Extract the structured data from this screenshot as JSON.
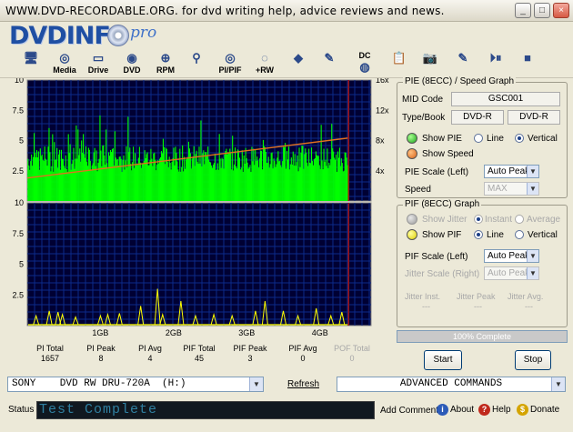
{
  "window": {
    "title": "WWW.DVD-RECORDABLE.ORG.    for dvd writing help, advice reviews and news.",
    "controls": [
      "_",
      "□",
      "×"
    ]
  },
  "logo": {
    "main": "DVDINF",
    "suffix": "pro"
  },
  "toolbar": [
    {
      "label": "",
      "icon": "monitor-icon"
    },
    {
      "label": "Media",
      "icon": "disc-icon"
    },
    {
      "label": "Drive",
      "icon": "drive-icon"
    },
    {
      "label": "DVD",
      "icon": "dvd-icon"
    },
    {
      "label": "RPM",
      "icon": "rpm-icon"
    },
    {
      "label": "",
      "icon": "scan-icon"
    },
    {
      "label": "PI/PIF",
      "icon": "pipif-icon"
    },
    {
      "label": "+RW",
      "icon": "plusrw-icon"
    },
    {
      "label": "",
      "icon": "eraser-icon"
    },
    {
      "label": "",
      "icon": "burn-icon"
    },
    {
      "label": "DC",
      "icon": "dc-icon"
    },
    {
      "label": "",
      "icon": "clipboard-icon"
    },
    {
      "label": "",
      "icon": "camera-icon"
    },
    {
      "label": "",
      "icon": "edit-icon"
    },
    {
      "label": "",
      "icon": "play-pause-icon"
    },
    {
      "label": "",
      "icon": "stop-icon"
    }
  ],
  "chart_data": [
    {
      "type": "bar",
      "title": "",
      "y_left_ticks": [
        "10",
        "7.5",
        "5",
        "2.5"
      ],
      "y_right_ticks": [
        "16x",
        "12x",
        "8x",
        "4x"
      ],
      "ylim": [
        0,
        10
      ],
      "series": [
        {
          "name": "PIE",
          "color": "#00ff00",
          "approx_level": 3.5,
          "peak": 8
        },
        {
          "name": "Speed",
          "color": "#e07020",
          "start": 1.9,
          "end": 5.2
        }
      ]
    },
    {
      "type": "bar",
      "title": "",
      "y_left_ticks": [
        "10",
        "7.5",
        "5",
        "2.5"
      ],
      "x_ticks": [
        "1GB",
        "2GB",
        "3GB",
        "4GB"
      ],
      "ylim": [
        0,
        10
      ],
      "series": [
        {
          "name": "PIF",
          "color": "#ffff00",
          "spikes": [
            {
              "x": 0.12,
              "v": 0.8
            },
            {
              "x": 0.3,
              "v": 1.2
            },
            {
              "x": 0.42,
              "v": 1.1
            },
            {
              "x": 0.48,
              "v": 0.9
            },
            {
              "x": 0.66,
              "v": 0.7
            },
            {
              "x": 1.0,
              "v": 0.8
            },
            {
              "x": 1.1,
              "v": 0.9
            },
            {
              "x": 1.26,
              "v": 1.0
            },
            {
              "x": 1.55,
              "v": 1.6
            },
            {
              "x": 1.78,
              "v": 3.0
            },
            {
              "x": 1.85,
              "v": 0.9
            },
            {
              "x": 2.1,
              "v": 2.0
            },
            {
              "x": 2.3,
              "v": 0.8
            },
            {
              "x": 2.55,
              "v": 0.9
            },
            {
              "x": 2.8,
              "v": 0.8
            },
            {
              "x": 3.12,
              "v": 1.2
            },
            {
              "x": 3.25,
              "v": 2.0
            },
            {
              "x": 3.5,
              "v": 1.2
            },
            {
              "x": 3.7,
              "v": 0.8
            },
            {
              "x": 3.95,
              "v": 1.4
            },
            {
              "x": 4.15,
              "v": 0.8
            },
            {
              "x": 4.3,
              "v": 1.1
            }
          ]
        }
      ]
    }
  ],
  "stats": [
    {
      "label": "PI Total",
      "value": "1657"
    },
    {
      "label": "PI Peak",
      "value": "8"
    },
    {
      "label": "PI Avg",
      "value": "4"
    },
    {
      "label": "PIF Total",
      "value": "45"
    },
    {
      "label": "PIF Peak",
      "value": "3"
    },
    {
      "label": "PIF Avg",
      "value": "0"
    },
    {
      "label": "POF Total",
      "value": "0"
    }
  ],
  "pie_panel": {
    "title": "PIE (8ECC) / Speed Graph",
    "mid_label": "MID Code",
    "mid_value": "GSC001",
    "type_label": "Type/Book",
    "type_value": "DVD-R",
    "book_value": "DVD-R",
    "show_pie": "Show PIE",
    "line": "Line",
    "vertical": "Vertical",
    "show_speed": "Show Speed",
    "pie_scale_label": "PIE Scale (Left)",
    "pie_scale_value": "Auto Peak",
    "speed_label": "Speed",
    "speed_value": "MAX"
  },
  "pif_panel": {
    "title": "PIF (8ECC) Graph",
    "show_jitter": "Show Jitter",
    "instant": "Instant",
    "average": "Average",
    "show_pif": "Show PIF",
    "line": "Line",
    "vertical": "Vertical",
    "pif_scale_label": "PIF Scale (Left)",
    "pif_scale_value": "Auto Peak",
    "jitter_scale_label": "Jitter Scale (Right)",
    "jitter_scale_value": "Auto Peak",
    "jitter_inst": "Jitter Inst.",
    "jitter_peak": "Jitter Peak",
    "jitter_avg": "Jitter Avg.",
    "jitter_inst_val": "---",
    "jitter_peak_val": "---",
    "jitter_avg_val": "---"
  },
  "progress": {
    "text": "100% Complete",
    "value": 1.0
  },
  "buttons": {
    "start": "Start",
    "stop": "Stop"
  },
  "bottom": {
    "drive": "SONY    DVD RW DRU-720A  (H:)",
    "refresh": "Refresh",
    "advanced": "ADVANCED COMMANDS",
    "status_label": "Status",
    "status_text": "Test Complete",
    "add_comment": "Add Comment",
    "about": "About",
    "help": "Help",
    "donate": "Donate"
  }
}
